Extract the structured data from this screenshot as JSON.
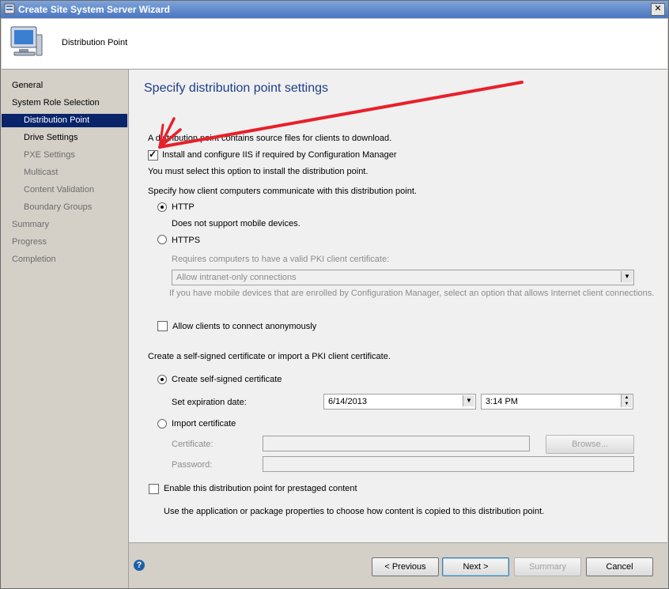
{
  "window": {
    "title": "Create Site System Server Wizard",
    "close_glyph": "✕"
  },
  "header": {
    "label": "Distribution Point"
  },
  "sidebar": {
    "items": [
      {
        "label": "General"
      },
      {
        "label": "System Role Selection"
      },
      {
        "label": "Distribution Point"
      },
      {
        "label": "Drive Settings"
      },
      {
        "label": "PXE Settings"
      },
      {
        "label": "Multicast"
      },
      {
        "label": "Content Validation"
      },
      {
        "label": "Boundary Groups"
      },
      {
        "label": "Summary"
      },
      {
        "label": "Progress"
      },
      {
        "label": "Completion"
      }
    ]
  },
  "main": {
    "heading": "Specify distribution point settings",
    "intro": "A distribution point contains source files for clients to download.",
    "install_iis": {
      "label": "Install and configure IIS if required by Configuration Manager",
      "checked": true
    },
    "install_note": "You must select this option to install the distribution point.",
    "comm_prompt": "Specify how client computers communicate with this distribution point.",
    "http": {
      "label": "HTTP",
      "note": "Does not support mobile devices.",
      "selected": true
    },
    "https": {
      "label": "HTTPS",
      "note": "Requires computers to have a valid PKI client certificate:",
      "selected": false
    },
    "intranet_select": {
      "value": "Allow intranet-only connections"
    },
    "mobile_note": "If you have mobile devices that are enrolled by Configuration Manager, select an option that allows Internet client connections.",
    "allow_anon": {
      "label": "Allow clients to connect anonymously",
      "checked": false
    },
    "cert_prompt": "Create a self-signed certificate or import a PKI client certificate.",
    "self_signed": {
      "label": "Create self-signed certificate",
      "selected": true
    },
    "expiration": {
      "label": "Set expiration date:",
      "date": "6/14/2013",
      "time": "3:14 PM"
    },
    "import_cert": {
      "label": "Import certificate",
      "selected": false
    },
    "certificate": {
      "label": "Certificate:",
      "value": ""
    },
    "browse_label": "Browse...",
    "password": {
      "label": "Password:",
      "value": ""
    },
    "prestaged": {
      "label": "Enable this distribution point for prestaged content",
      "checked": false
    },
    "prestaged_note": "Use the application or package properties to choose how content is copied to this distribution point."
  },
  "footer": {
    "help_glyph": "?",
    "previous": "< Previous",
    "next": "Next >",
    "summary": "Summary",
    "cancel": "Cancel"
  },
  "colors": {
    "accent": "#0a246a",
    "heading": "#1f3d8a",
    "annotation_arrow": "#e8202a"
  }
}
